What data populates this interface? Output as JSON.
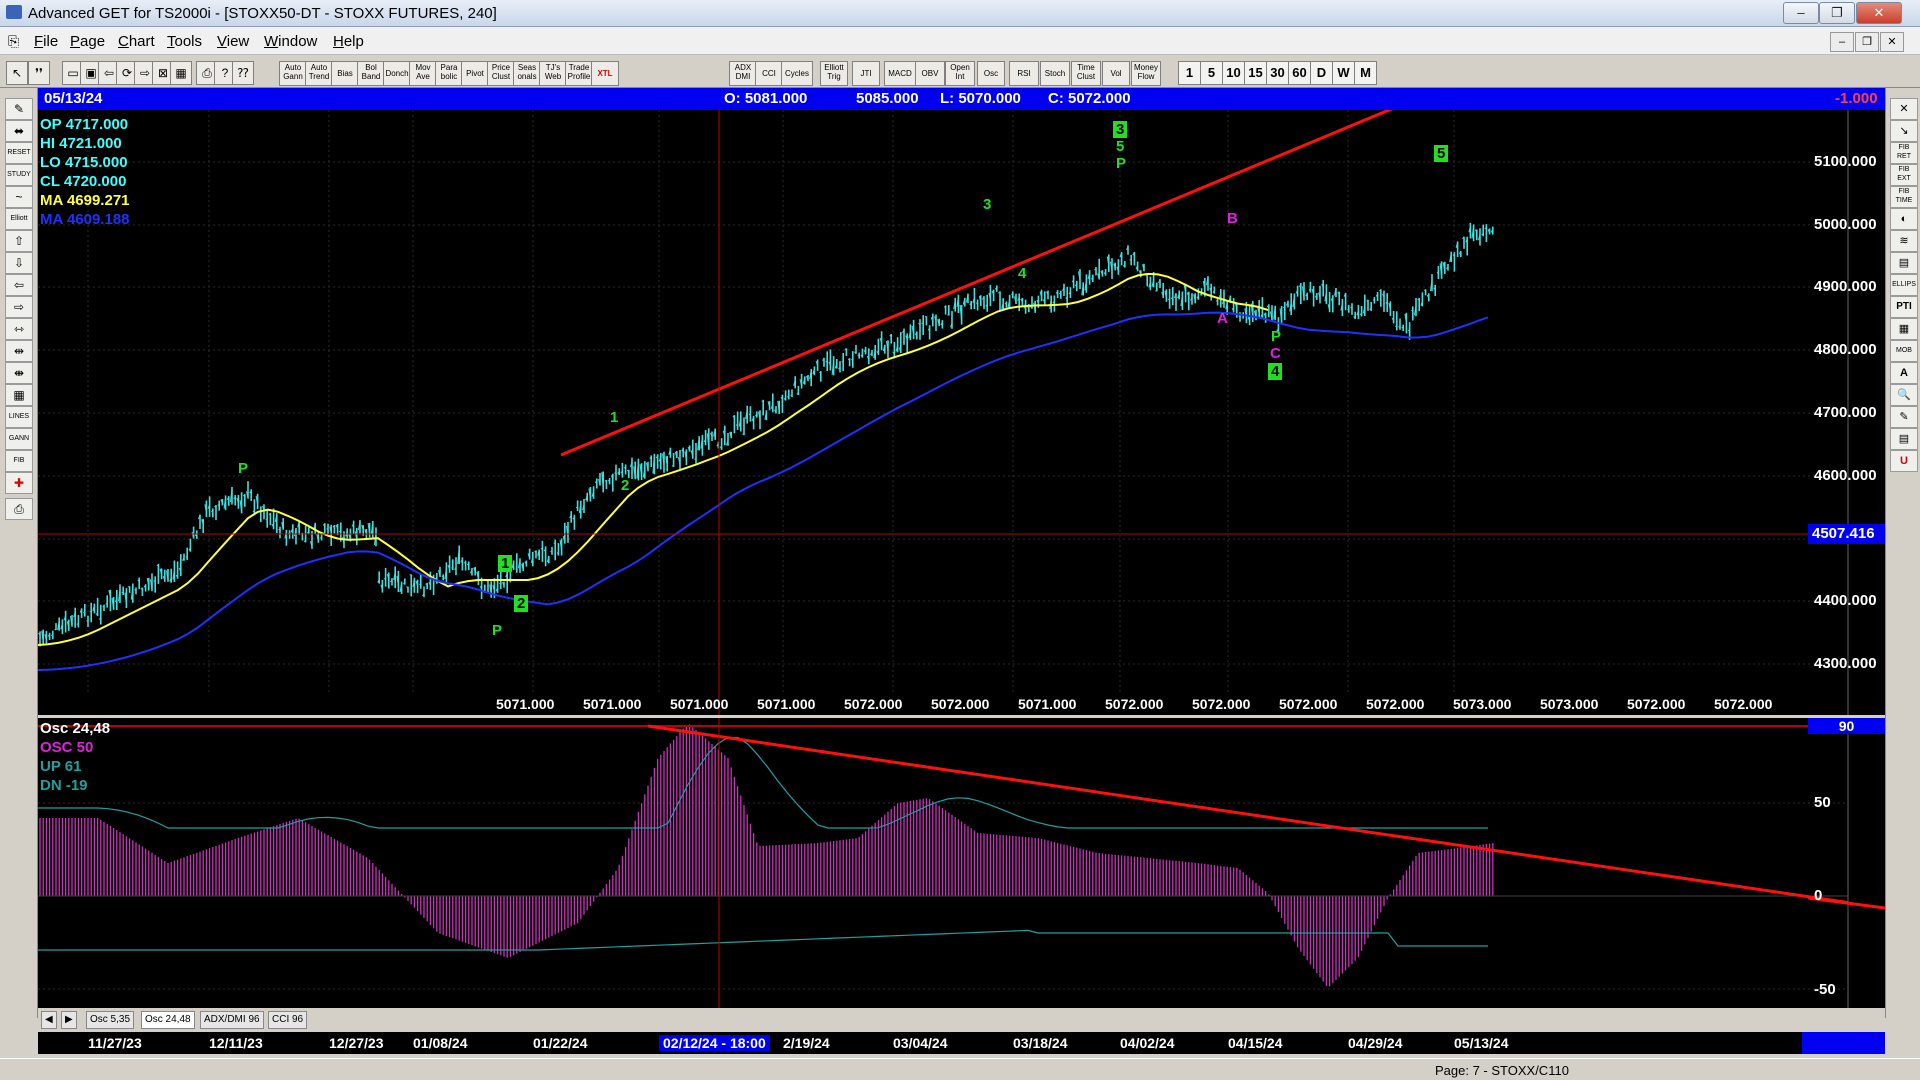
{
  "window": {
    "title": "Advanced GET for TS2000i - [STOXX50-DT - STOXX FUTURES, 240]",
    "min": "–",
    "max": "❐",
    "close": "✕"
  },
  "menu": [
    "File",
    "Page",
    "Chart",
    "Tools",
    "View",
    "Window",
    "Help"
  ],
  "toolbar": {
    "indicators": [
      "Auto Gann",
      "Auto Trend",
      "Bias",
      "Bol Band",
      "Donch",
      "Mov Ave",
      "Para bolic",
      "Pivot",
      "Price Clust",
      "Seas onals",
      "TJ's Web",
      "Trade Profile",
      "XTL",
      "ADX DMI",
      "CCI",
      "Cycles",
      "Elliott Trig",
      "JTI",
      "MACD",
      "OBV",
      "Open Int",
      "Osc",
      "RSI",
      "Stoch",
      "Time Clust",
      "Vol",
      "Money Flow"
    ],
    "intervals": [
      "1",
      "5",
      "10",
      "15",
      "30",
      "60",
      "D",
      "W",
      "M"
    ]
  },
  "left_tools": [
    "✎",
    "⬌",
    "RESET",
    "STUDY",
    "~",
    "Elliott",
    "⇧",
    "⇩",
    "⇦",
    "⇨",
    "⇿",
    "⇹",
    "⇼",
    "▦",
    "LINES",
    "GANN",
    "FIB",
    "✚",
    "⎙"
  ],
  "right_tools": [
    "✕",
    "↘",
    "FIB RET",
    "FIB EXT",
    "FIB TIME",
    "◐",
    "≋",
    "▤",
    "ELLIPS",
    "PTI",
    "▦",
    "MOB",
    "A",
    "🔍",
    "✎",
    "▤",
    "U"
  ],
  "header": {
    "date": "05/13/24",
    "open": "O: 5081.000",
    "high": "5085.000",
    "low": "L: 5070.000",
    "close": "C: 5072.000",
    "change": "-1.000"
  },
  "legend": {
    "op": "OP 4717.000",
    "hi": "HI  4721.000",
    "lo": "LO  4715.000",
    "cl": "CL  4720.000",
    "ma1": "MA 4699.271",
    "ma2": "MA 4609.188"
  },
  "price_axis": {
    "ticks": [
      "5100.000",
      "5000.000",
      "4900.000",
      "4800.000",
      "4700.000",
      "4600.000",
      "4500.000",
      "4400.000",
      "4300.000"
    ],
    "cursor_value": "4507.416"
  },
  "bottom_values": [
    "5071.000",
    "5071.000",
    "5071.000",
    "5071.000",
    "5072.000",
    "5072.000",
    "5071.000",
    "5072.000",
    "5072.000",
    "5072.000",
    "5072.000",
    "5073.000",
    "5073.000",
    "5072.000"
  ],
  "bottom_value_last": "5072.000",
  "wave_labels": {
    "p1": "P",
    "p2": "P",
    "p3": "P",
    "p4": "P",
    "w1a": "1",
    "w2a": "2",
    "w1b": "1",
    "w2b": "2",
    "w3a": "3",
    "w4a": "4",
    "w3b": "3",
    "w5a": "5",
    "a": "A",
    "b": "B",
    "c": "C",
    "w4b": "4",
    "w5b": "5"
  },
  "osc_legend": {
    "title": "Osc 24,48",
    "osc": "OSC 50",
    "up": "UP   61",
    "dn": "DN   -19"
  },
  "osc_axis": {
    "ticks": [
      "50",
      "0",
      "-50"
    ],
    "top_value": "90"
  },
  "osc_tabs": [
    "Osc 5,35",
    "Osc 24,48",
    "ADX/DMI 96",
    "CCI 96"
  ],
  "dates": [
    "11/27/23",
    "12/11/23",
    "12/27/23",
    "01/08/24",
    "01/22/24",
    "2/19/24",
    "03/04/24",
    "03/18/24",
    "04/02/24",
    "04/15/24",
    "04/29/24",
    "05/13/24"
  ],
  "cursor_date": "02/12/24 - 18:00",
  "status": "Page: 7 - STOXX/C110"
}
